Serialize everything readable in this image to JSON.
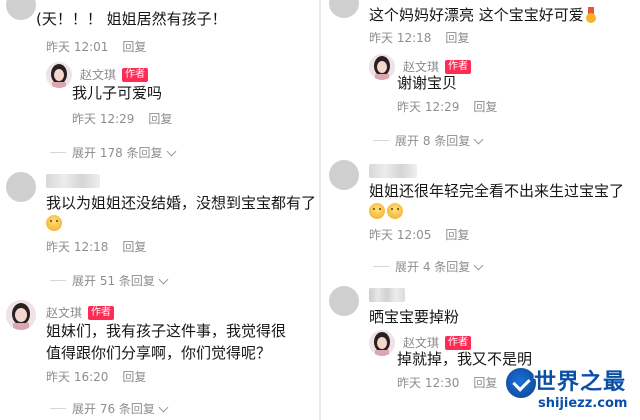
{
  "left": {
    "c1": {
      "text": "(天！！！ 姐姐居然有孩子！",
      "time": "昨天 12:01",
      "reply": "回复"
    },
    "r1": {
      "author": "赵文琪",
      "badge": "作者",
      "text": "我儿子可爱吗",
      "time": "昨天 12:29",
      "reply": "回复"
    },
    "expand1": {
      "label": "展开 178 条回复"
    },
    "c2": {
      "text": "我以为姐姐还没结婚，没想到宝宝都有了",
      "emoji": "pleading-face",
      "time": "昨天 12:18",
      "reply": "回复"
    },
    "expand2": {
      "label": "展开 51 条回复"
    },
    "c3": {
      "author": "赵文琪",
      "badge": "作者",
      "text": "姐妹们，我有孩子这件事，我觉得很值得跟你们分享啊，你们觉得呢？",
      "time": "昨天 16:20",
      "reply": "回复"
    },
    "expand3": {
      "label": "展开 76 条回复"
    }
  },
  "right": {
    "c1": {
      "text": "这个妈妈好漂亮 这个宝宝好可爱",
      "emoji": "medal",
      "time": "昨天 12:18",
      "reply": "回复"
    },
    "r1": {
      "author": "赵文琪",
      "badge": "作者",
      "text": "谢谢宝贝",
      "time": "昨天 12:29",
      "reply": "回复"
    },
    "expand1": {
      "label": "展开 8 条回复"
    },
    "c2": {
      "text": "姐姐还很年轻完全看不出来生过宝宝了",
      "emoji": "pleading-face",
      "time": "昨天 12:05",
      "reply": "回复"
    },
    "expand2": {
      "label": "展开 4 条回复"
    },
    "c3": {
      "text": "晒宝宝要掉粉"
    },
    "r3": {
      "author": "赵文琪",
      "badge": "作者",
      "text": "掉就掉，我又不是明",
      "time": "昨天 12:30",
      "reply": "回复"
    }
  },
  "watermark": {
    "title": "世界之最",
    "url": "shijiezz.com"
  },
  "colors": {
    "badge": "#fe2c55",
    "meta": "#8e8e8e",
    "watermark": "#0b4fa8"
  }
}
